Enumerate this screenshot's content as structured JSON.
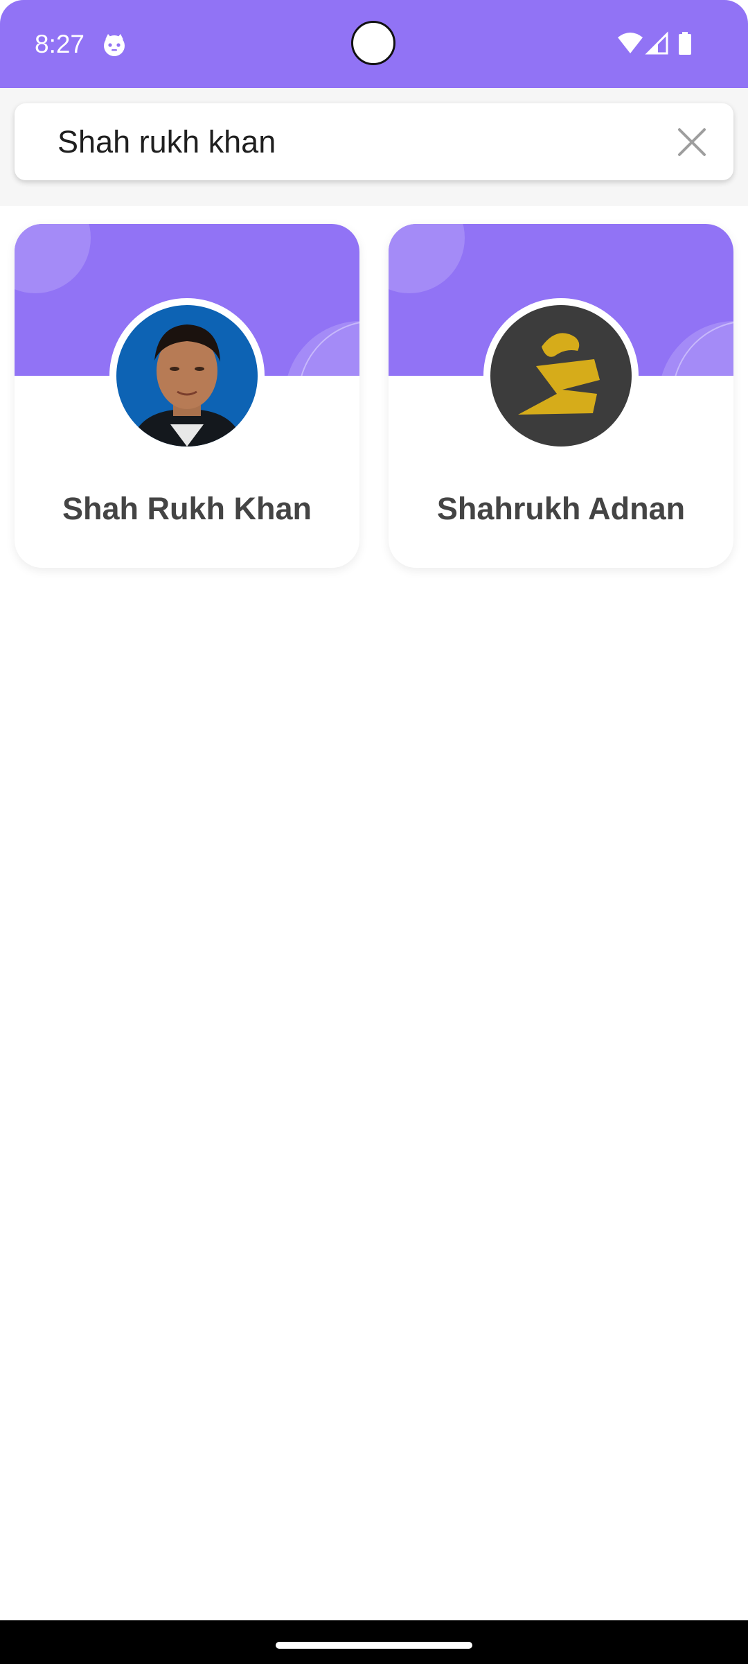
{
  "status_bar": {
    "time": "8:27",
    "icons": [
      "cat-notification-icon",
      "wifi-icon",
      "signal-icon",
      "battery-icon"
    ]
  },
  "search": {
    "value": "Shah rukh khan",
    "clear_icon": "close-icon"
  },
  "results": [
    {
      "name": "Shah Rukh Khan",
      "avatar": "portrait-photo"
    },
    {
      "name": "Shahrukh Adnan",
      "avatar": "yellow-logo-on-dark"
    }
  ],
  "colors": {
    "accent": "#9173f5",
    "banner_circle": "#a48bf7",
    "name_text": "#444444",
    "logo_bg": "#3c3c3c",
    "logo_mark": "#d6ac1a"
  }
}
